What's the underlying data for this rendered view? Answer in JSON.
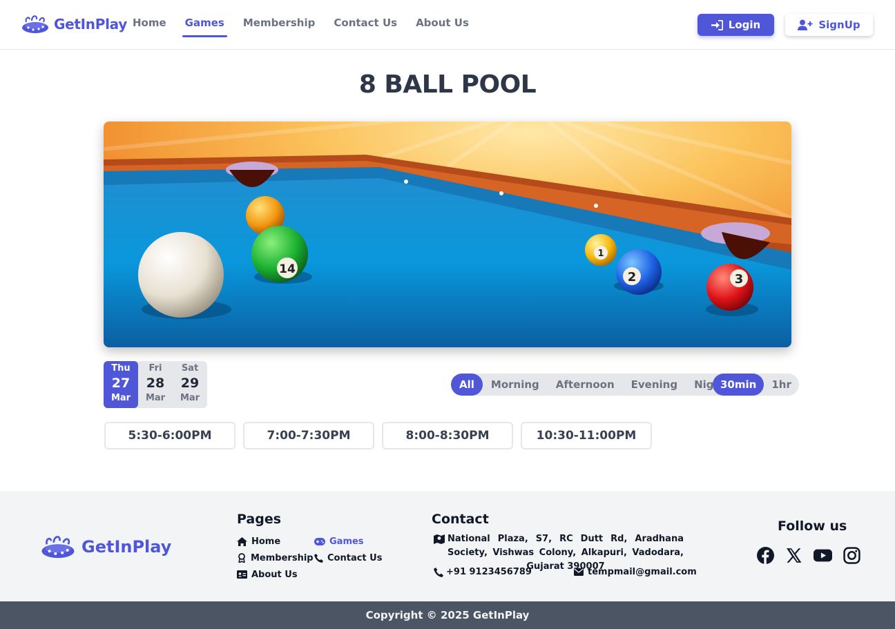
{
  "nav": {
    "brand": "GetInPlay",
    "links": [
      "Home",
      "Games",
      "Membership",
      "Contact Us",
      "About Us"
    ],
    "active_link": "Games",
    "login_label": "Login",
    "signup_label": "SignUp"
  },
  "game": {
    "title": "8 BALL POOL"
  },
  "dates": [
    {
      "day": "Thu",
      "num": "27",
      "month": "Mar",
      "selected": true
    },
    {
      "day": "Fri",
      "num": "28",
      "month": "Mar",
      "selected": false
    },
    {
      "day": "Sat",
      "num": "29",
      "month": "Mar",
      "selected": false
    }
  ],
  "filters": {
    "times": [
      "All",
      "Morning",
      "Afternoon",
      "Evening",
      "Night"
    ],
    "selected_time": "All",
    "durations": [
      "30min",
      "1hr"
    ],
    "selected_duration": "30min"
  },
  "slots": [
    "5:30-6:00PM",
    "7:00-7:30PM",
    "8:00-8:30PM",
    "10:30-11:00PM"
  ],
  "footer": {
    "brand": "GetInPlay",
    "pages_heading": "Pages",
    "pages": [
      {
        "label": "Home",
        "icon": "home-icon"
      },
      {
        "label": "Games",
        "icon": "gamepad-icon",
        "active": true
      },
      {
        "label": "Membership",
        "icon": "award-icon"
      },
      {
        "label": "Contact Us",
        "icon": "phone-icon"
      },
      {
        "label": "About Us",
        "icon": "id-card-icon"
      }
    ],
    "contact_heading": "Contact",
    "address": "National Plaza, S7, RC Dutt Rd, Aradhana Society, Vishwas Colony, Alkapuri, Vadodara, Gujarat 390007",
    "phone": "+91 9123456789",
    "email": "tempmail@gmail.com",
    "follow_heading": "Follow us",
    "social": [
      "facebook-icon",
      "x-icon",
      "youtube-icon",
      "instagram-icon"
    ],
    "copyright": "Copyright © 2025 GetInPlay"
  },
  "colors": {
    "accent": "#4f56d8",
    "footer_bg": "#f3f4f6",
    "copyright_bg": "#4b5563"
  }
}
